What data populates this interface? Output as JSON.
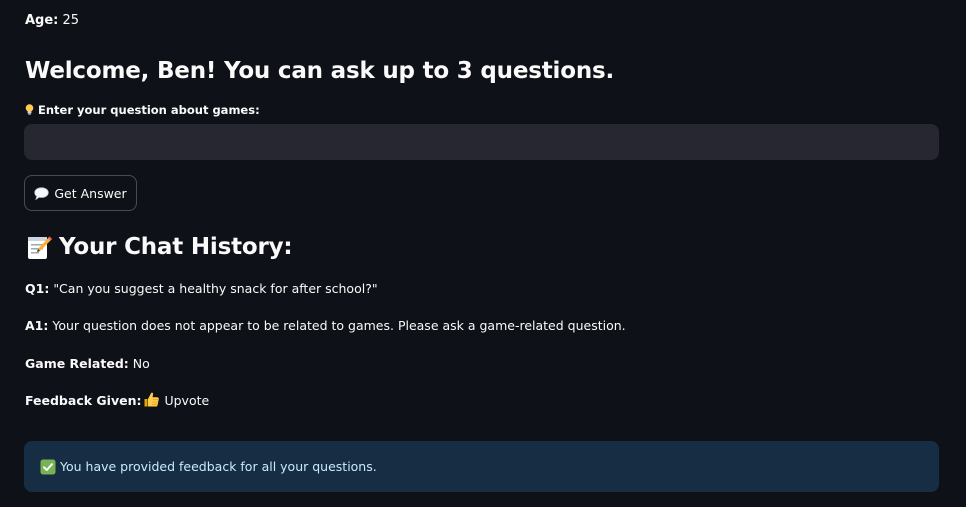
{
  "profile": {
    "age_label": "Age:",
    "age_value": "25"
  },
  "welcome": {
    "text": "Welcome, Ben! You can ask up to 3 questions."
  },
  "question_field": {
    "label": "Enter your question about games:",
    "label_icon": "lightbulb-icon",
    "value": "",
    "placeholder": ""
  },
  "answer_button": {
    "label": "Get Answer",
    "icon": "speech-bubble-icon"
  },
  "history": {
    "title_icon": "memo-icon",
    "title": "Your Chat History:",
    "items": [
      {
        "question_label": "Q1:",
        "question": "\"Can you suggest a healthy snack for after school?\"",
        "answer_label": "A1:",
        "answer": "Your question does not appear to be related to games. Please ask a game-related question.",
        "game_related_label": "Game Related:",
        "game_related": "No",
        "feedback_label": "Feedback Given:",
        "feedback_icon": "thumbs-up-icon",
        "feedback": "Upvote"
      }
    ]
  },
  "status": {
    "icon": "check-mark-icon",
    "message": "You have provided feedback for all your questions.",
    "background": "#172d43",
    "text_color": "#c7ebff"
  },
  "theme": {
    "background": "#0e1117",
    "input_background": "#262730",
    "text": "#fafafa"
  }
}
